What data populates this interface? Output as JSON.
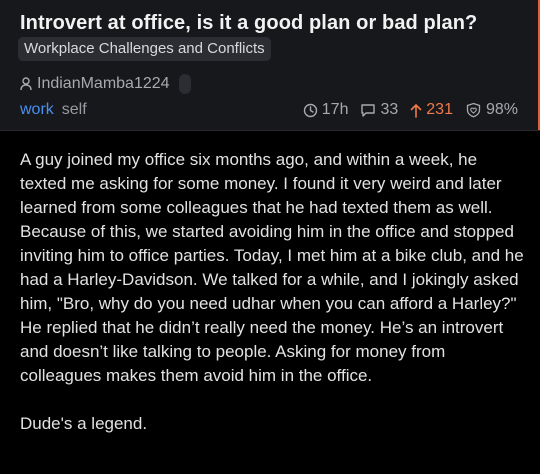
{
  "post": {
    "title": "Introvert at office, is it a good plan or bad plan?",
    "flair": "Workplace Challenges and Conflicts",
    "author": "IndianMamba1224",
    "tags": [
      "work",
      "self"
    ],
    "stats": {
      "age": "17h",
      "comments": "33",
      "upvotes": "231",
      "upvote_ratio": "98%"
    },
    "paragraphs": [
      "A guy joined my office six months ago, and within a week, he texted me asking for some money. I found it very weird and later learned from some colleagues that he had texted them as well. Because of this, we started avoiding him in the office and stopped inviting him to office parties. Today, I met him at a bike club, and he had a Harley-Davidson. We talked for a while, and I jokingly asked him, \"Bro, why do you need udhar when you can afford a Harley?\" He replied that he didn’t really need the money. He’s an introvert and doesn’t like talking to people. Asking for money from colleagues makes them avoid him in the office.",
      "Dude's a legend."
    ]
  },
  "colors": {
    "background": "#000000",
    "header_bg": "#17181b",
    "tag_accent": "#4b8ff0",
    "upvote_accent": "#f07a4a"
  },
  "icons": {
    "author": "user-icon",
    "age": "clock-icon",
    "comments": "comment-icon",
    "upvotes": "arrow-up-icon",
    "ratio": "heart-shield-icon"
  }
}
